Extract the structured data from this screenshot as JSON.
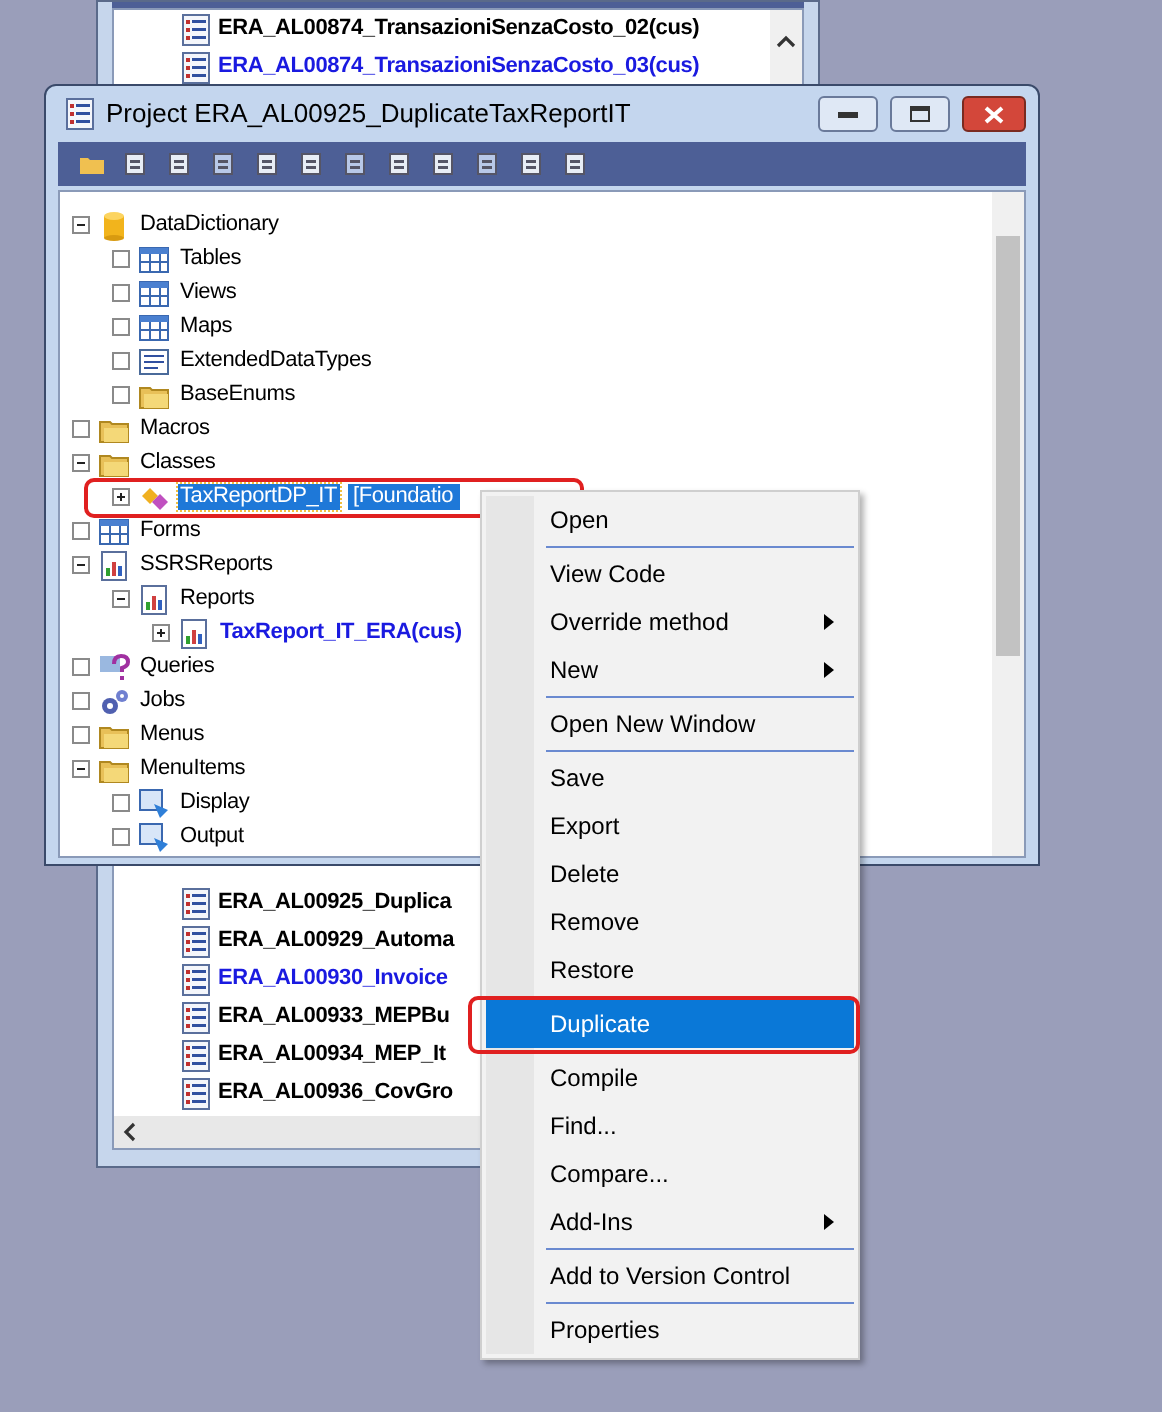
{
  "background_window": {
    "rows_top": [
      {
        "label": "ERA_AL00874_TransazioniSenzaCosto_02(cus)",
        "marked": false
      },
      {
        "label": "ERA_AL00874_TransazioniSenzaCosto_03(cus)",
        "marked": true
      }
    ],
    "rows_bottom": [
      {
        "label": "ERA_AL00925_Duplica",
        "marked": false
      },
      {
        "label": "ERA_AL00929_Automa",
        "marked": false
      },
      {
        "label": "ERA_AL00930_Invoice",
        "marked": true
      },
      {
        "label": "ERA_AL00933_MEPBu",
        "marked": false
      },
      {
        "label": "ERA_AL00934_MEP_It",
        "marked": false
      },
      {
        "label": "ERA_AL00936_CovGro",
        "marked": false
      }
    ]
  },
  "window": {
    "title": "Project ERA_AL00925_DuplicateTaxReportIT"
  },
  "tree": [
    {
      "label": "DataDictionary",
      "expandable": true,
      "expanded": true,
      "selected": false,
      "marked": false,
      "children": [
        {
          "label": "Tables",
          "expandable": false,
          "selected": false,
          "marked": false
        },
        {
          "label": "Views",
          "expandable": false,
          "selected": false,
          "marked": false
        },
        {
          "label": "Maps",
          "expandable": false,
          "selected": false,
          "marked": false
        },
        {
          "label": "ExtendedDataTypes",
          "expandable": false,
          "selected": false,
          "marked": false
        },
        {
          "label": "BaseEnums",
          "expandable": false,
          "selected": false,
          "marked": false
        }
      ]
    },
    {
      "label": "Macros",
      "expandable": false,
      "selected": false,
      "marked": false
    },
    {
      "label": "Classes",
      "expandable": true,
      "expanded": true,
      "selected": false,
      "marked": false,
      "children": [
        {
          "label": "TaxReportDP_IT",
          "suffix": "[Foundatio",
          "expandable": true,
          "expanded": false,
          "selected": true,
          "marked": false
        }
      ]
    },
    {
      "label": "Forms",
      "expandable": false,
      "selected": false,
      "marked": false
    },
    {
      "label": "SSRSReports",
      "expandable": true,
      "expanded": true,
      "selected": false,
      "marked": false,
      "children": [
        {
          "label": "Reports",
          "expandable": true,
          "expanded": true,
          "selected": false,
          "marked": false,
          "children": [
            {
              "label": "TaxReport_IT_ERA(cus)",
              "expandable": true,
              "expanded": false,
              "selected": false,
              "marked": true
            }
          ]
        }
      ]
    },
    {
      "label": "Queries",
      "expandable": false,
      "selected": false,
      "marked": false
    },
    {
      "label": "Jobs",
      "expandable": false,
      "selected": false,
      "marked": false
    },
    {
      "label": "Menus",
      "expandable": false,
      "selected": false,
      "marked": false
    },
    {
      "label": "MenuItems",
      "expandable": true,
      "expanded": true,
      "selected": false,
      "marked": false,
      "children": [
        {
          "label": "Display",
          "expandable": false,
          "selected": false,
          "marked": false
        },
        {
          "label": "Output",
          "expandable": false,
          "selected": false,
          "marked": false
        }
      ]
    }
  ],
  "context_menu": {
    "items": [
      {
        "kind": "item",
        "label": "Open",
        "submenu": false,
        "selected": false
      },
      {
        "kind": "separator"
      },
      {
        "kind": "item",
        "label": "View Code",
        "submenu": false,
        "selected": false
      },
      {
        "kind": "item",
        "label": "Override method",
        "submenu": true,
        "selected": false
      },
      {
        "kind": "item",
        "label": "New",
        "submenu": true,
        "selected": false
      },
      {
        "kind": "separator"
      },
      {
        "kind": "item",
        "label": "Open New Window",
        "submenu": false,
        "selected": false
      },
      {
        "kind": "separator"
      },
      {
        "kind": "item",
        "label": "Save",
        "submenu": false,
        "selected": false
      },
      {
        "kind": "item",
        "label": "Export",
        "submenu": false,
        "selected": false
      },
      {
        "kind": "item",
        "label": "Delete",
        "submenu": false,
        "selected": false
      },
      {
        "kind": "item",
        "label": "Remove",
        "submenu": false,
        "selected": false
      },
      {
        "kind": "item",
        "label": "Restore",
        "submenu": false,
        "selected": false
      },
      {
        "kind": "item",
        "label": "Duplicate",
        "submenu": false,
        "selected": true
      },
      {
        "kind": "item",
        "label": "Compile",
        "submenu": false,
        "selected": false
      },
      {
        "kind": "item",
        "label": "Find...",
        "submenu": false,
        "selected": false
      },
      {
        "kind": "item",
        "label": "Compare...",
        "submenu": false,
        "selected": false
      },
      {
        "kind": "item",
        "label": "Add-Ins",
        "submenu": true,
        "selected": false
      },
      {
        "kind": "separator"
      },
      {
        "kind": "item",
        "label": "Add to Version Control",
        "submenu": false,
        "selected": false
      },
      {
        "kind": "separator"
      },
      {
        "kind": "item",
        "label": "Properties",
        "submenu": false,
        "selected": false
      }
    ]
  }
}
